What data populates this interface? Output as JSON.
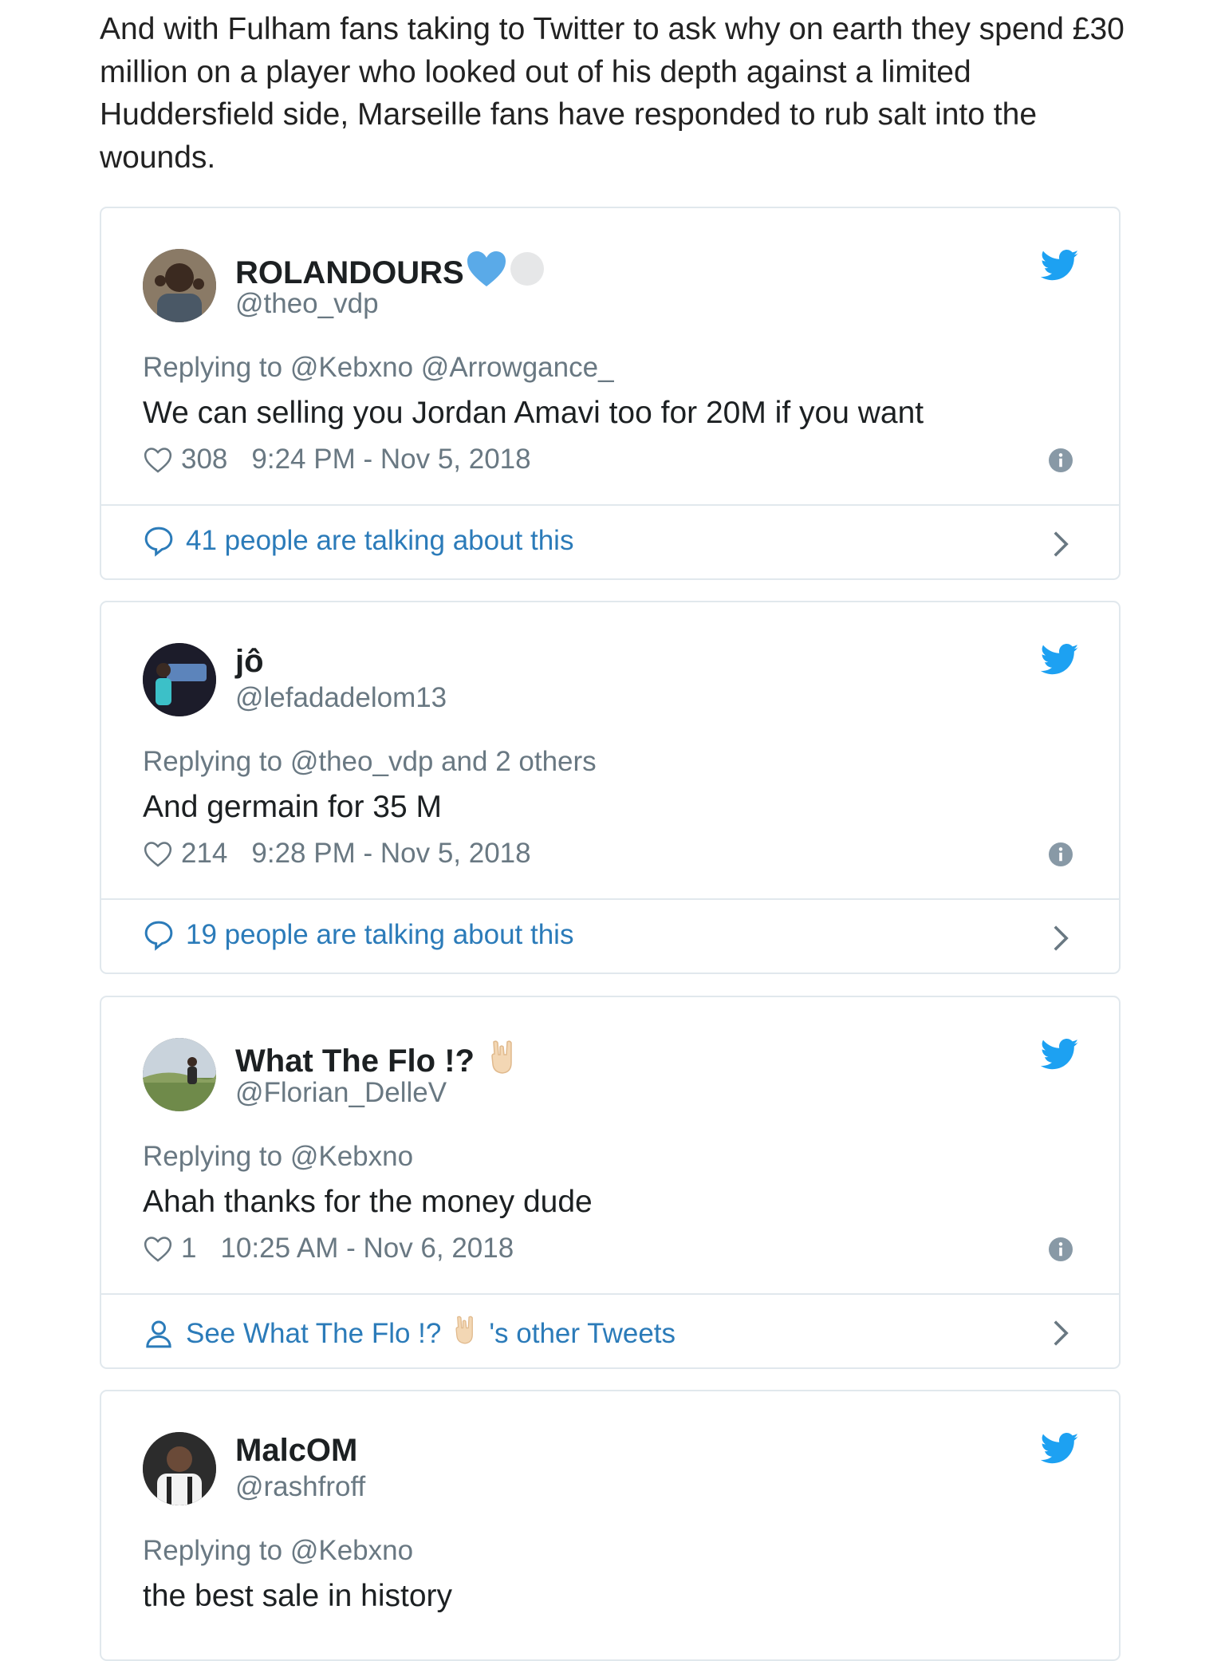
{
  "article": {
    "paragraph": "And with Fulham fans taking to Twitter to ask why on earth they spend £30 million on a player who looked out of his depth against a limited Huddersfield side, Marseille fans have responded to rub salt into the wounds."
  },
  "colors": {
    "twitter_blue": "#1da1f2",
    "link_blue": "#2b7bb9",
    "gray_text": "#697882",
    "border": "#e1e8ed"
  },
  "tweets": [
    {
      "display_name": "ROLANDOURS",
      "name_emojis": [
        "blue-heart-icon",
        "white-circle-icon"
      ],
      "handle": "@theo_vdp",
      "replying_to": "Replying to @Kebxno @Arrowgance_",
      "text": "We can selling you Jordan Amavi too for 20M if you want",
      "likes": "308",
      "timestamp": "9:24 PM - Nov 5, 2018",
      "footer": "41 people are talking about this",
      "footer_icon": "speech-bubble-icon"
    },
    {
      "display_name": "jô",
      "handle": "@lefadadelom13",
      "replying_to": "Replying to @theo_vdp and 2 others",
      "text": "And germain for 35 M",
      "likes": "214",
      "timestamp": "9:28 PM - Nov 5, 2018",
      "footer": "19 people are talking about this",
      "footer_icon": "speech-bubble-icon"
    },
    {
      "display_name": "What The Flo !?",
      "name_emojis": [
        "rock-hand-icon"
      ],
      "handle": "@Florian_DelleV",
      "replying_to": "Replying to @Kebxno",
      "text": "Ahah thanks for the money dude",
      "likes": "1",
      "timestamp": "10:25 AM - Nov 6, 2018",
      "footer_prefix": "See What The Flo !?",
      "footer_suffix": "'s other Tweets",
      "footer_icon": "person-icon"
    },
    {
      "display_name": "MalcOM",
      "handle": "@rashfroff",
      "replying_to": "Replying to @Kebxno",
      "text": "the best sale in history"
    }
  ]
}
